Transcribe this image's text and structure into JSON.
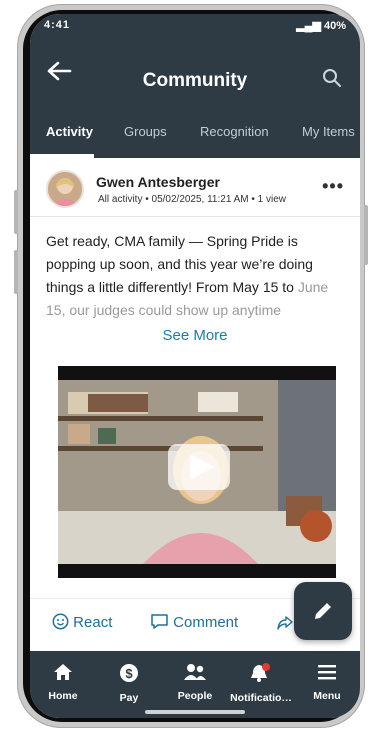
{
  "status_bar": {
    "time": "4:41",
    "battery": "40%"
  },
  "header": {
    "title": "Community"
  },
  "tabs": [
    {
      "label": "Activity",
      "active": true
    },
    {
      "label": "Groups",
      "active": false
    },
    {
      "label": "Recognition",
      "active": false
    },
    {
      "label": "My Items",
      "active": false
    }
  ],
  "post": {
    "author": "Gwen Antesberger",
    "meta": "All activity • 05/02/2025, 11:21 AM • 1 view",
    "more_label": "•••",
    "body_main": "Get ready, CMA family — Spring Pride is popping up soon, and this year we’re doing things a little differently! From May 15 to ",
    "body_fade": "June 15, our judges could show up anytime",
    "see_more": "See More",
    "actions": {
      "react": "React",
      "comment": "Comment"
    }
  },
  "bottom_nav": [
    {
      "label": "Home",
      "icon": "home-icon"
    },
    {
      "label": "Pay",
      "icon": "pay-icon"
    },
    {
      "label": "People",
      "icon": "people-icon"
    },
    {
      "label": "Notificatio…",
      "icon": "notification-bell-icon"
    },
    {
      "label": "Menu",
      "icon": "menu-icon"
    }
  ],
  "colors": {
    "header": "#2e3b44",
    "accent": "#1e7ba6",
    "notification_dot": "#e53935"
  }
}
